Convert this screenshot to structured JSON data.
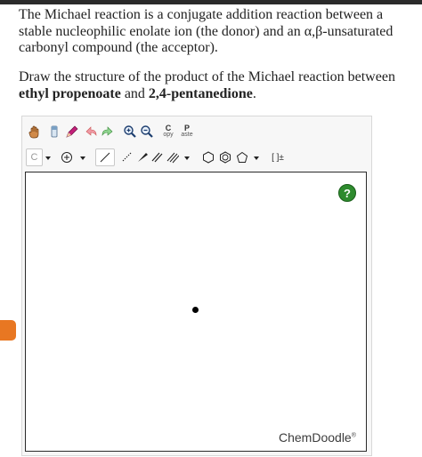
{
  "question": {
    "intro": "The Michael reaction is a conjugate addition reaction between a stable nucleophilic enolate ion (the donor) and an α,β-unsaturated carbonyl compound (the acceptor).",
    "prompt_prefix": "Draw the structure of the product of the Michael reaction between",
    "reactant1": "ethyl propenoate",
    "conjunction": " and ",
    "reactant2": "2,4-pentanedione",
    "end": "."
  },
  "toolbar": {
    "row1": [
      {
        "name": "hand-icon"
      },
      {
        "name": "eraser-icon"
      },
      {
        "name": "pencil-icon"
      },
      {
        "name": "undo-icon"
      },
      {
        "name": "redo-icon"
      },
      {
        "name": "zoom-in-icon"
      },
      {
        "name": "zoom-out-icon"
      }
    ],
    "copy_top": "C",
    "copy_bottom": "opy",
    "paste_top": "P",
    "paste_bottom": "aste",
    "element_label": "C",
    "bracket_label": "[ ]±"
  },
  "canvas": {
    "help_label": "?",
    "brand": "ChemDoodle",
    "brand_mark": "®"
  },
  "colors": {
    "help": "#2e8b2e",
    "side_tab": "#e87722"
  }
}
